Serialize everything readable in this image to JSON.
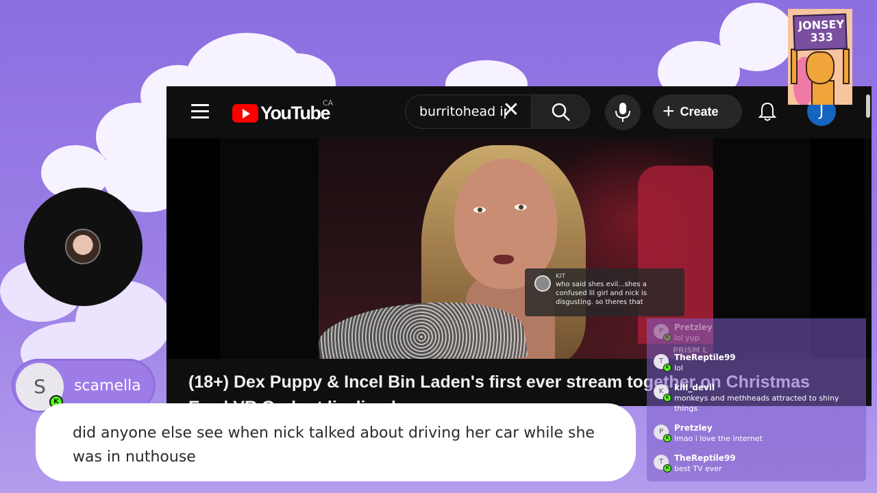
{
  "youtube": {
    "logo_text": "YouTube",
    "country": "CA",
    "search_value": "burritohead ip",
    "create_label": "Create",
    "avatar_letter": "J",
    "video_title": "(18+) Dex Puppy & Incel Bin Laden's first ever stream together on Christmas",
    "video_title_line2": "Eve | VR Go-kart livelined",
    "overlay_comment": {
      "name": "KIT",
      "text": "who said shes evil...shes a confused lil girl and nick is disgusting. so theres that"
    }
  },
  "logo": {
    "line1": "JONSEY",
    "line2": "333"
  },
  "speaker": {
    "initial": "S",
    "name": "scamella",
    "message": "did anyone else see when nick talked about driving her car while she was in nuthouse"
  },
  "chat": {
    "faded_items": [
      {
        "initial": "P",
        "name": "Pretzley",
        "message": "lol yup"
      }
    ],
    "faded_overlay": "PRISM L",
    "items": [
      {
        "initial": "T",
        "name": "TheReptile99",
        "message": "lol"
      },
      {
        "initial": "K",
        "name": "kill_devil",
        "message": "monkeys and methheads attracted to shiny things"
      },
      {
        "initial": "P",
        "name": "Pretzley",
        "message": "lmao i love the internet"
      },
      {
        "initial": "T",
        "name": "TheReptile99",
        "message": "best TV ever"
      }
    ]
  },
  "colors": {
    "background": "#9b7fe6",
    "youtube_red": "#ff0000",
    "kick_green": "#53fc18",
    "chip_purple": "#9d7ce8"
  }
}
